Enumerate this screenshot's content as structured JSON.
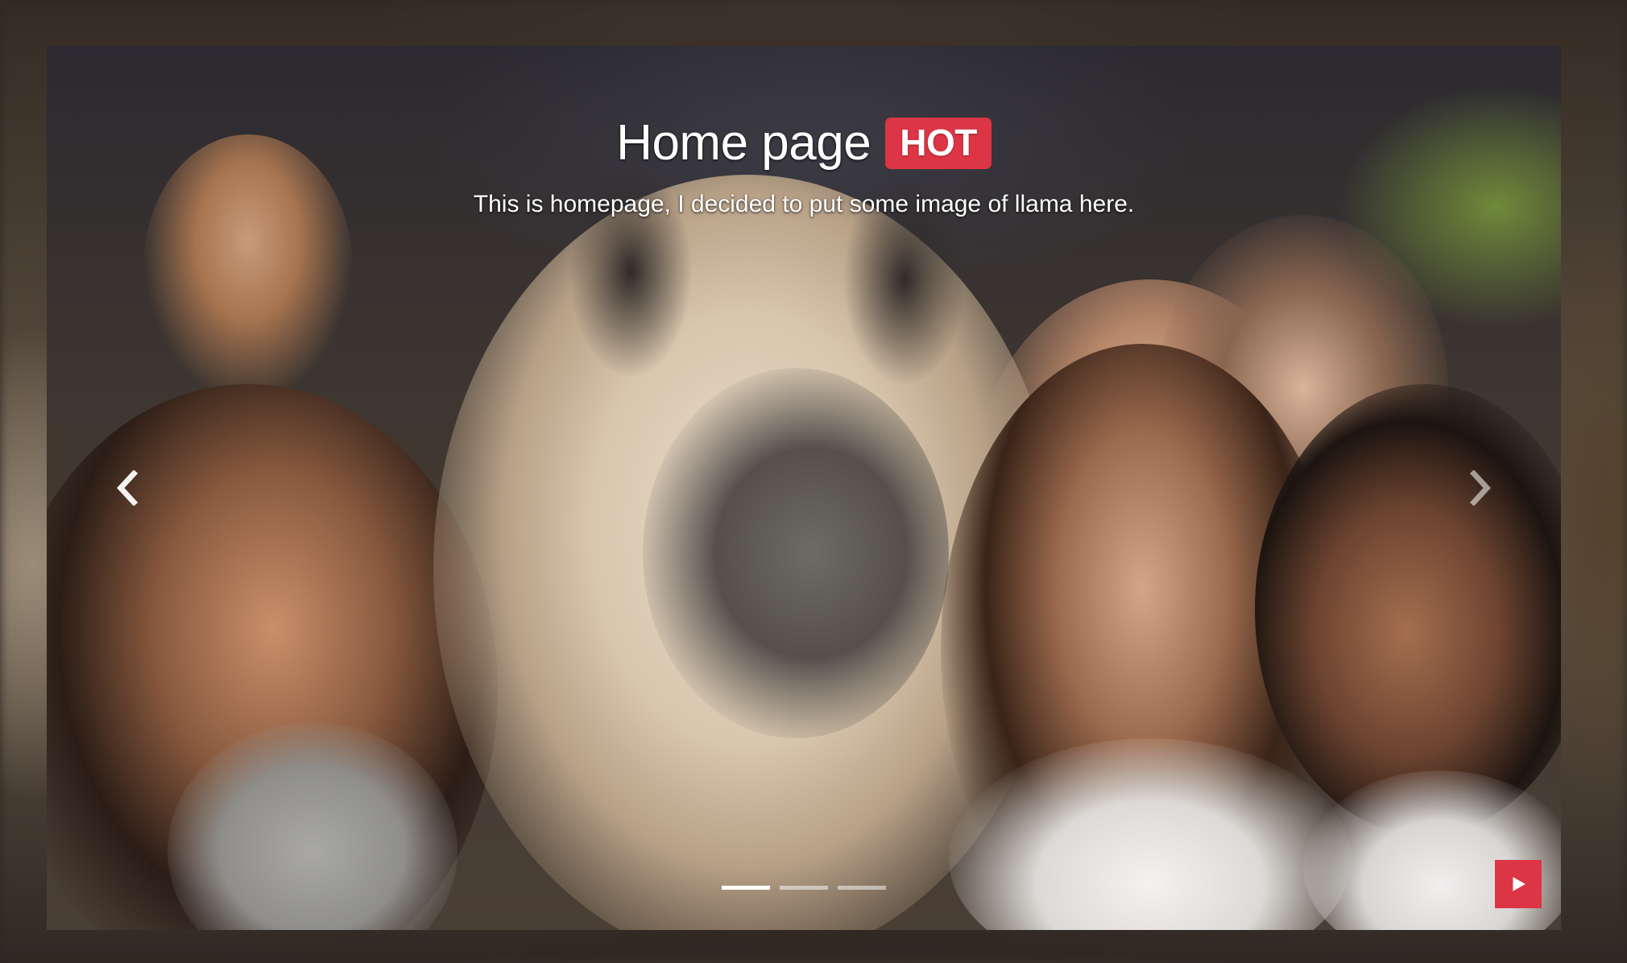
{
  "slide": {
    "title": "Home page",
    "badge": "HOT",
    "subtitle": "This is homepage, I decided to put some image of llama here."
  },
  "carousel": {
    "indicators": [
      {
        "active": true
      },
      {
        "active": false
      },
      {
        "active": false
      }
    ],
    "prev_icon": "chevron-left-icon",
    "next_icon": "chevron-right-icon",
    "play_icon": "play-icon"
  },
  "colors": {
    "accent": "#dc3545",
    "text": "#ffffff"
  }
}
